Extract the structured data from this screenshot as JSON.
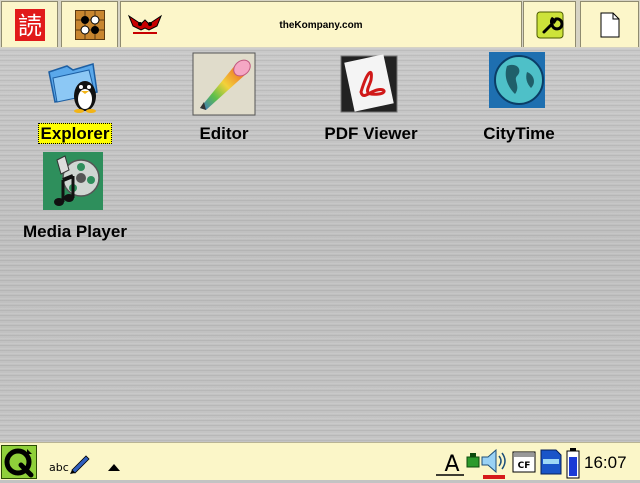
{
  "top_bar": {
    "tabs": [
      {
        "id": "kanji",
        "icon": "kanji-character-icon",
        "glyph": "読",
        "accent": "#e11a1a"
      },
      {
        "id": "games",
        "icon": "game-board-icon"
      },
      {
        "id": "applications",
        "icon": "thekompany-logo-icon",
        "title": "theKompany.com"
      },
      {
        "id": "settings",
        "icon": "wrench-settings-icon"
      },
      {
        "id": "documents",
        "icon": "document-icon"
      }
    ]
  },
  "desktop": {
    "apps": [
      {
        "label": "Explorer",
        "icon": "folder-penguin-icon",
        "selected": true
      },
      {
        "label": "Editor",
        "icon": "pencil-editor-icon",
        "selected": false
      },
      {
        "label": "PDF Viewer",
        "icon": "pdf-icon",
        "selected": false
      },
      {
        "label": "CityTime",
        "icon": "globe-clock-icon",
        "selected": false
      },
      {
        "label": "Media Player",
        "icon": "film-music-icon",
        "selected": false
      }
    ]
  },
  "taskbar": {
    "start_icon": "qtopia-q-icon",
    "input_method_text": "abc",
    "tray_icons": [
      "text-input-icon",
      "network-icon",
      "volume-icon",
      "cf-card-icon",
      "sd-card-icon",
      "battery-icon"
    ],
    "cf_label": "CF",
    "text_input_glyph": "A",
    "clock": "16:07"
  },
  "colors": {
    "bar_background": "#fcf6c9",
    "selection_highlight": "#ffff00",
    "desktop_background": "#c3c3c3"
  }
}
